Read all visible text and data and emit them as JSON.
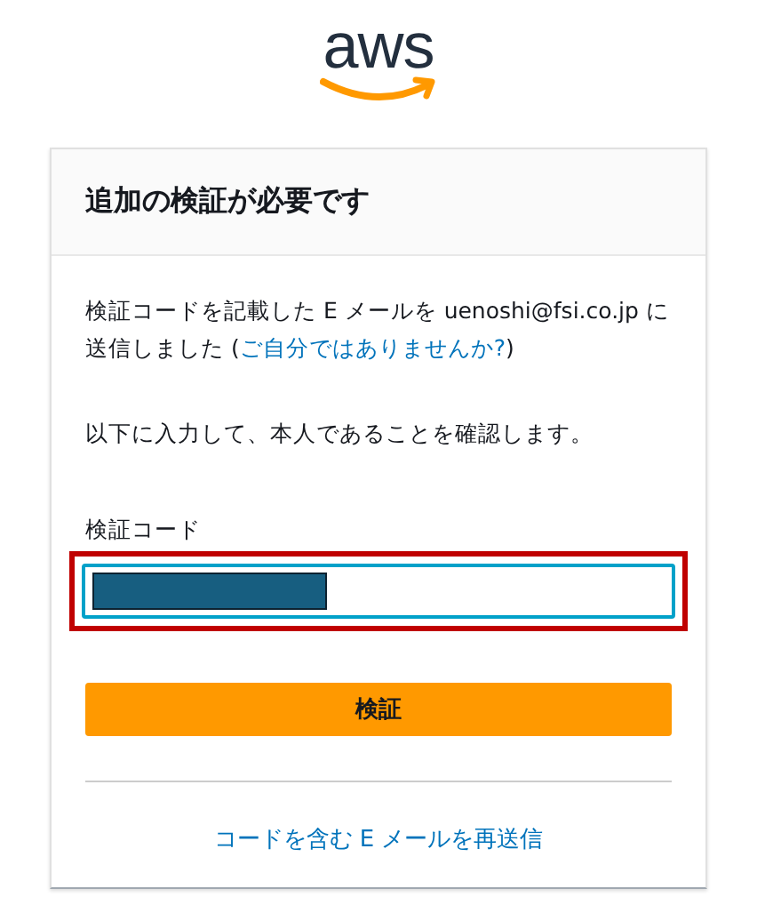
{
  "logo": {
    "text": "aws"
  },
  "card": {
    "title": "追加の検証が必要です",
    "message": {
      "before": "検証コードを記載した E メールを uenoshi@fsi.co.jp に送信しました (",
      "link": "ご自分ではありませんか?",
      "after": ")"
    },
    "instruction": "以下に入力して、本人であることを確認します。",
    "field": {
      "label": "検証コード",
      "redacted": true,
      "highlighted": true
    },
    "submit_button": "検証",
    "resend_link": "コードを含む E メールを再送信"
  }
}
